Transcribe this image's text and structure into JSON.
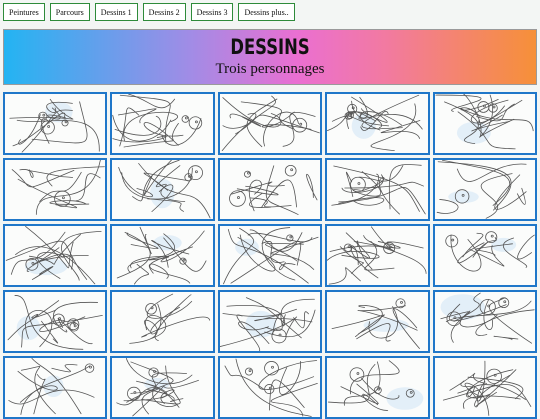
{
  "nav": {
    "items": [
      {
        "label": "Peintures"
      },
      {
        "label": "Parcours"
      },
      {
        "label": "Dessins 1"
      },
      {
        "label": "Dessins 2"
      },
      {
        "label": "Dessins 3"
      },
      {
        "label": "Dessins plus.."
      }
    ]
  },
  "header": {
    "title": "DESSINS",
    "subtitle": "Trois personnages"
  },
  "colors": {
    "nav_border": "#2e8b3a",
    "thumb_border": "#1f77c9",
    "banner_gradient": [
      "#23b4f2",
      "#a18ce6",
      "#ea6fd2",
      "#f27aa0",
      "#f69038"
    ]
  },
  "gallery": {
    "columns": 5,
    "visible_rows": 5,
    "thumbnail_count": 25
  }
}
